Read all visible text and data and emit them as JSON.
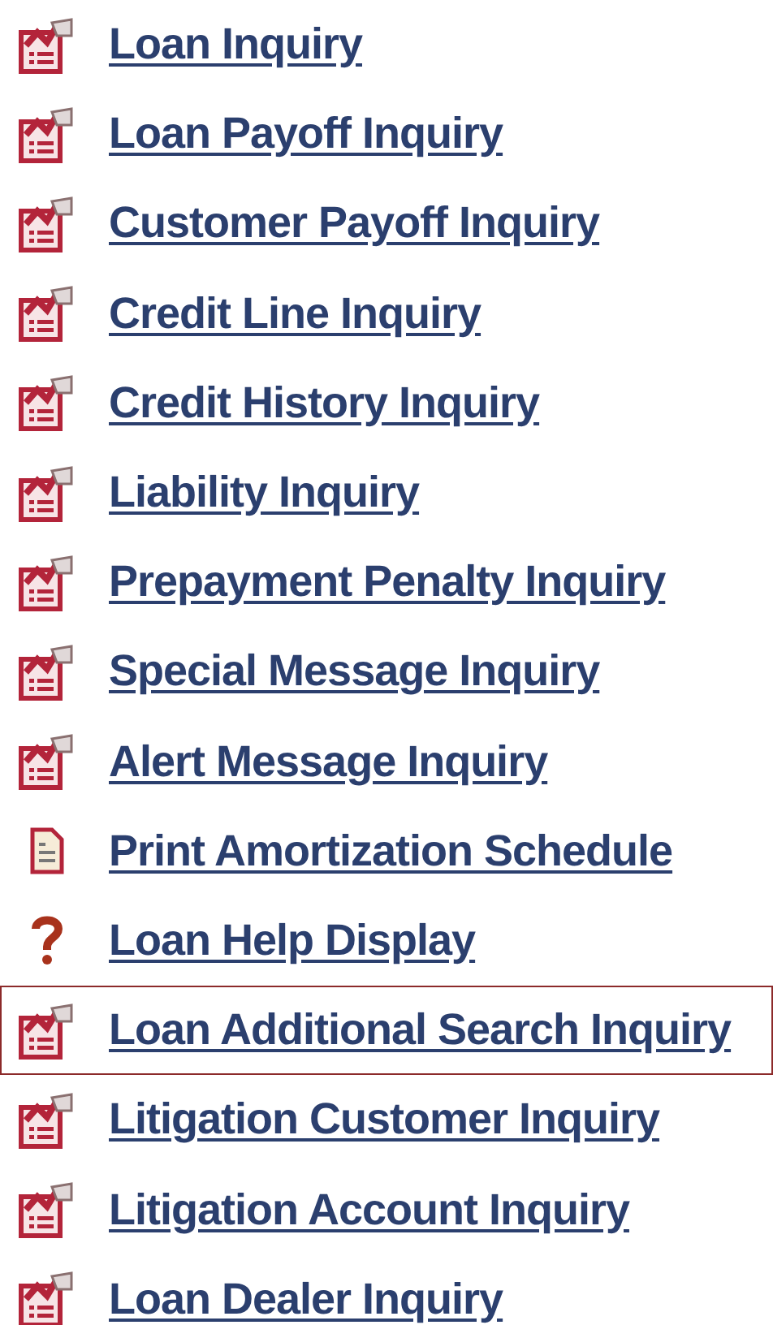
{
  "menu": {
    "items": [
      {
        "kind": "form",
        "label": "Loan Inquiry",
        "selected": false
      },
      {
        "kind": "form",
        "label": "Loan Payoff Inquiry",
        "selected": false
      },
      {
        "kind": "form",
        "label": "Customer Payoff Inquiry",
        "selected": false
      },
      {
        "kind": "form",
        "label": "Credit Line Inquiry",
        "selected": false
      },
      {
        "kind": "form",
        "label": "Credit History Inquiry",
        "selected": false
      },
      {
        "kind": "form",
        "label": "Liability Inquiry",
        "selected": false
      },
      {
        "kind": "form",
        "label": "Prepayment Penalty Inquiry",
        "selected": false
      },
      {
        "kind": "form",
        "label": "Special Message Inquiry",
        "selected": false
      },
      {
        "kind": "form",
        "label": "Alert Message Inquiry",
        "selected": false
      },
      {
        "kind": "document",
        "label": "Print Amortization Schedule",
        "selected": false
      },
      {
        "kind": "help",
        "label": "Loan Help Display",
        "selected": false
      },
      {
        "kind": "form",
        "label": "Loan Additional Search Inquiry",
        "selected": true
      },
      {
        "kind": "form",
        "label": "Litigation Customer Inquiry",
        "selected": false
      },
      {
        "kind": "form",
        "label": "Litigation Account Inquiry",
        "selected": false
      },
      {
        "kind": "form",
        "label": "Loan Dealer Inquiry",
        "selected": false
      }
    ]
  }
}
